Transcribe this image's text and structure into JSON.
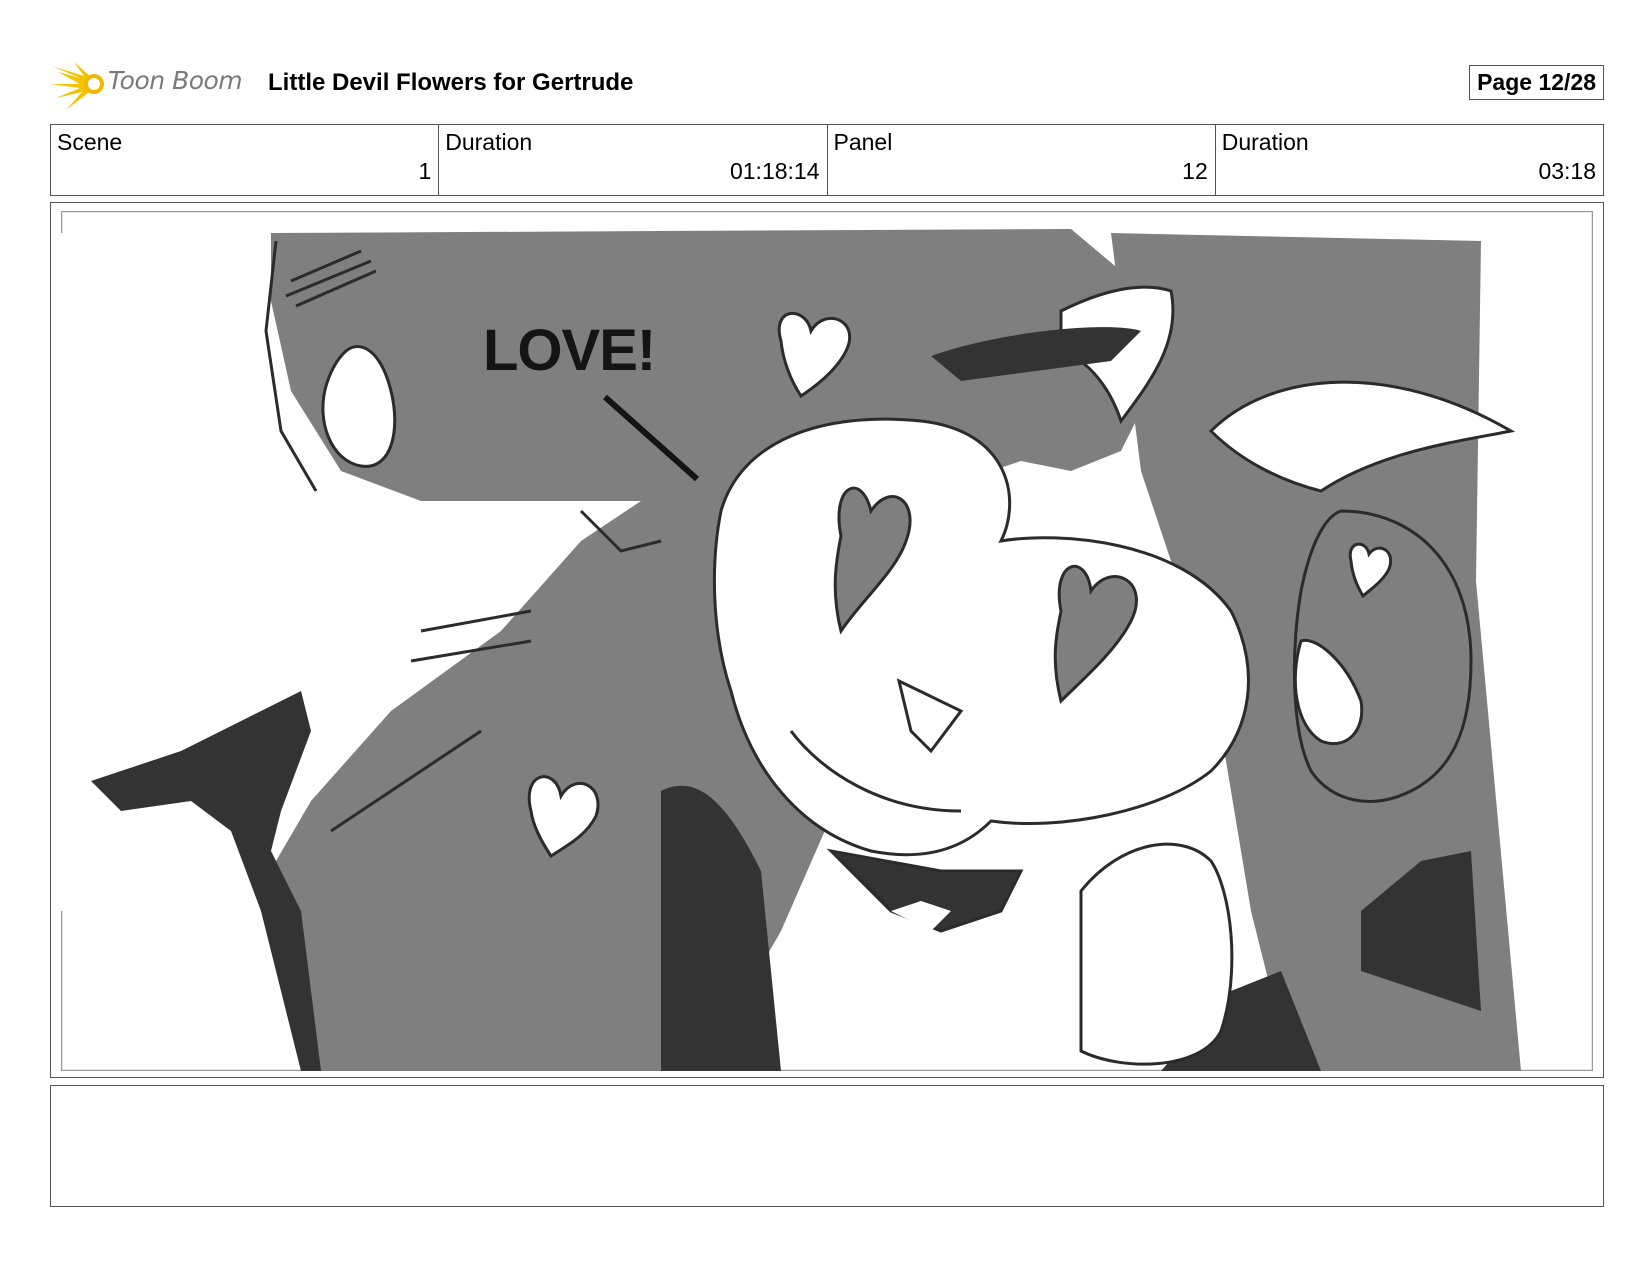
{
  "header": {
    "logo_text": "Toon Boom",
    "title": "Little Devil Flowers for Gertrude",
    "page": "Page 12/28"
  },
  "info": [
    {
      "label": "Scene",
      "value": "1"
    },
    {
      "label": "Duration",
      "value": "01:18:14"
    },
    {
      "label": "Panel",
      "value": "12"
    },
    {
      "label": "Duration",
      "value": "03:18"
    }
  ],
  "panel": {
    "sfx_text": "LOVE!"
  },
  "notes": {
    "text": ""
  },
  "colors": {
    "sketch_gray": "#7f7f7f",
    "ink": "#2b2b2b",
    "logo_yellow": "#f5c400"
  }
}
